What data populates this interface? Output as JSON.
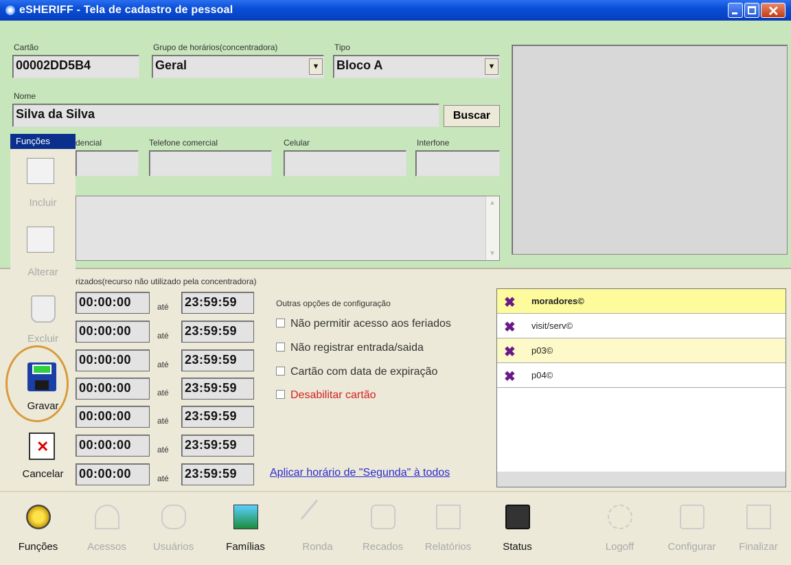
{
  "window": {
    "title": "eSHERIFF - Tela de cadastro de pessoal"
  },
  "form": {
    "cartao_label": "Cartão",
    "cartao_value": "00002DD5B4",
    "grupo_label": "Grupo de horários(concentradora)",
    "grupo_value": "Geral",
    "tipo_label": "Tipo",
    "tipo_value": "Bloco A",
    "nome_label": "Nome",
    "nome_value": "Silva da Silva",
    "buscar_label": "Buscar",
    "tel_res_label": "dencial",
    "tel_com_label": "Telefone comercial",
    "celular_label": "Celular",
    "interfone_label": "Interfone"
  },
  "sidebar": {
    "title": "Funções",
    "items": [
      {
        "label": "Incluir"
      },
      {
        "label": "Alterar"
      },
      {
        "label": "Excluir"
      },
      {
        "label": "Gravar"
      },
      {
        "label": "Cancelar"
      }
    ]
  },
  "schedule": {
    "header": "rizados(recurso não utilizado pela concentradora)",
    "ate": "até",
    "rows": [
      {
        "from": "00:00:00",
        "to": "23:59:59"
      },
      {
        "from": "00:00:00",
        "to": "23:59:59"
      },
      {
        "from": "00:00:00",
        "to": "23:59:59"
      },
      {
        "from": "00:00:00",
        "to": "23:59:59"
      },
      {
        "from": "00:00:00",
        "to": "23:59:59"
      },
      {
        "from": "00:00:00",
        "to": "23:59:59"
      },
      {
        "from": "00:00:00",
        "to": "23:59:59"
      }
    ],
    "apply_link": "Aplicar horário de \"Segunda\" à todos"
  },
  "options": {
    "title": "Outras opções de configuração",
    "items": [
      {
        "label": "Não permitir acesso aos feriados",
        "checked": false
      },
      {
        "label": "Não registrar entrada/saida",
        "checked": false
      },
      {
        "label": "Cartão com data de expiração",
        "checked": false
      },
      {
        "label": "Desabilitar cartão",
        "checked": false,
        "color": "#d42020"
      }
    ]
  },
  "groups_list": [
    {
      "label": "moradores©",
      "highlight": "#fdfb9c",
      "bold": true
    },
    {
      "label": "visit/serv©",
      "highlight": "#ffffff",
      "bold": false
    },
    {
      "label": "p03©",
      "highlight": "#fdf9c8",
      "bold": false
    },
    {
      "label": "p04©",
      "highlight": "#ffffff",
      "bold": false
    }
  ],
  "toolbar": [
    {
      "label": "Funções",
      "icon": "functions-gear-icon",
      "enabled": true
    },
    {
      "label": "Acessos",
      "icon": "access-icon",
      "enabled": false
    },
    {
      "label": "Usuários",
      "icon": "users-icon",
      "enabled": false
    },
    {
      "label": "Famílias",
      "icon": "families-icon",
      "enabled": true
    },
    {
      "label": "Ronda",
      "icon": "flashlight-icon",
      "enabled": false
    },
    {
      "label": "Recados",
      "icon": "messages-icon",
      "enabled": false
    },
    {
      "label": "Relatórios",
      "icon": "reports-icon",
      "enabled": false
    },
    {
      "label": "Status",
      "icon": "status-icon",
      "enabled": true
    },
    {
      "label": "Logoff",
      "icon": "logoff-icon",
      "enabled": false
    },
    {
      "label": "Configurar",
      "icon": "configure-icon",
      "enabled": false
    },
    {
      "label": "Finalizar",
      "icon": "exit-icon",
      "enabled": false
    }
  ]
}
